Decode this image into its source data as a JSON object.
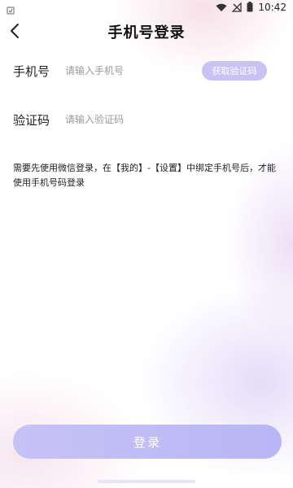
{
  "status_bar": {
    "left_icon": "notification-icon",
    "icons": [
      "wifi-icon",
      "no-signal-icon",
      "battery-icon"
    ],
    "time": "10:42"
  },
  "header": {
    "back_icon": "chevron-left-icon",
    "title": "手机号登录"
  },
  "form": {
    "phone_label": "手机号",
    "phone_placeholder": "请输入手机号",
    "phone_value": "",
    "get_code_label": "获取验证码",
    "code_label": "验证码",
    "code_placeholder": "请输入验证码",
    "code_value": ""
  },
  "notice": "需要先使用微信登录，在【我的】-【设置】中绑定手机号后，才能使用手机号码登录",
  "login_button": "登录",
  "colors": {
    "accent": "#c9c3f4",
    "button": "#bfbaf6",
    "text": "#222222",
    "placeholder": "#9a9a9a"
  }
}
